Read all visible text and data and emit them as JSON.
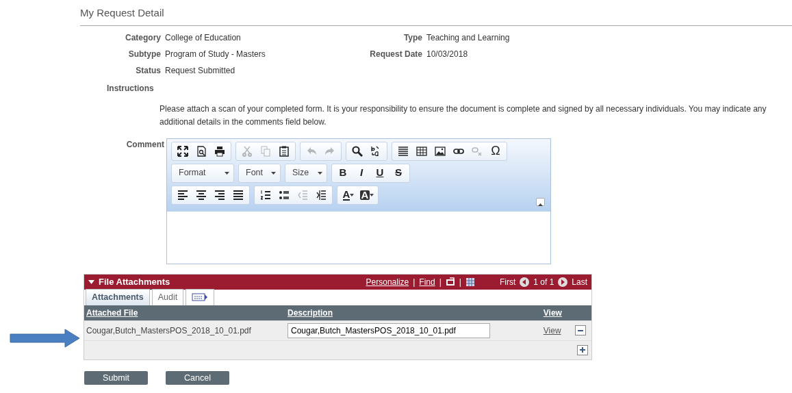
{
  "page_title": "My Request Detail",
  "fields": [
    {
      "label": "Category",
      "value": "College of Education"
    },
    {
      "label": "Type",
      "value": "Teaching and Learning"
    },
    {
      "label": "Subtype",
      "value": "Program of Study - Masters"
    },
    {
      "label": "Request Date",
      "value": "10/03/2018"
    },
    {
      "label": "Status",
      "value": "Request Submitted"
    }
  ],
  "instructions": {
    "label": "Instructions",
    "text": "Please attach a scan of your completed form. It is your responsibility to ensure the document is complete and signed by all necessary individuals. You may indicate any additional details in the comments field below."
  },
  "comment": {
    "label": "Comment",
    "toolbar_rows": [
      [
        {
          "kind": "group",
          "buttons": [
            {
              "kind": "maximize",
              "disabled": false
            },
            {
              "kind": "preview",
              "disabled": false
            },
            {
              "kind": "print",
              "disabled": false
            }
          ]
        },
        {
          "kind": "group",
          "buttons": [
            {
              "kind": "cut",
              "disabled": true
            },
            {
              "kind": "copy",
              "disabled": true
            },
            {
              "kind": "paste",
              "disabled": false
            }
          ]
        },
        {
          "kind": "group",
          "buttons": [
            {
              "kind": "undo",
              "disabled": true
            },
            {
              "kind": "redo",
              "disabled": true
            }
          ]
        },
        {
          "kind": "group",
          "buttons": [
            {
              "kind": "find",
              "disabled": false
            },
            {
              "kind": "replace",
              "disabled": false
            }
          ]
        },
        {
          "kind": "group",
          "buttons": [
            {
              "kind": "hrule",
              "disabled": false
            },
            {
              "kind": "table",
              "disabled": false
            },
            {
              "kind": "image",
              "disabled": false
            },
            {
              "kind": "link",
              "disabled": false
            },
            {
              "kind": "unlink",
              "disabled": true
            },
            {
              "kind": "glyph",
              "label": "Ω",
              "disabled": false
            }
          ]
        }
      ],
      [
        {
          "kind": "combo",
          "label": "Format"
        },
        {
          "kind": "combo",
          "label": "Font"
        },
        {
          "kind": "combo",
          "label": "Size"
        },
        {
          "kind": "group",
          "buttons": [
            {
              "kind": "bold",
              "label": "B",
              "disabled": false
            },
            {
              "kind": "italic",
              "label": "I",
              "disabled": false
            },
            {
              "kind": "underline",
              "label": "U",
              "disabled": false
            },
            {
              "kind": "strike",
              "label": "S",
              "disabled": false
            }
          ]
        }
      ],
      [
        {
          "kind": "group",
          "buttons": [
            {
              "kind": "align-left",
              "disabled": false
            },
            {
              "kind": "align-center",
              "disabled": false
            },
            {
              "kind": "align-right",
              "disabled": false
            },
            {
              "kind": "justify",
              "disabled": false
            }
          ]
        },
        {
          "kind": "group",
          "buttons": [
            {
              "kind": "numbered-list",
              "disabled": false
            },
            {
              "kind": "bullet-list",
              "disabled": false
            },
            {
              "kind": "outdent",
              "disabled": true
            },
            {
              "kind": "indent",
              "disabled": false
            }
          ]
        },
        {
          "kind": "group",
          "buttons": [
            {
              "kind": "text-color",
              "label": "A",
              "disabled": false
            },
            {
              "kind": "bg-color",
              "label": "A",
              "disabled": false
            }
          ]
        }
      ]
    ]
  },
  "attachments": {
    "title": "File Attachments",
    "header_items": [
      {
        "kind": "link",
        "label": "Personalize"
      },
      {
        "kind": "separator",
        "label": "|"
      },
      {
        "kind": "link",
        "label": "Find"
      },
      {
        "kind": "separator",
        "label": "|"
      },
      {
        "kind": "zoom"
      },
      {
        "kind": "separator",
        "label": "|"
      },
      {
        "kind": "download"
      }
    ],
    "nav": {
      "first": "First",
      "count": "1 of 1",
      "last": "Last"
    },
    "tabs": [
      {
        "label": "Attachments",
        "selected": true
      },
      {
        "label": "Audit",
        "selected": false
      }
    ],
    "columns": [
      "Attached File",
      "Description",
      "View"
    ],
    "rows": [
      {
        "file": "Cougar,Butch_MastersPOS_2018_10_01.pdf",
        "description": "Cougar,Butch_MastersPOS_2018_10_01.pdf",
        "view": "View"
      }
    ]
  },
  "buttons": [
    "Submit",
    "Cancel"
  ]
}
